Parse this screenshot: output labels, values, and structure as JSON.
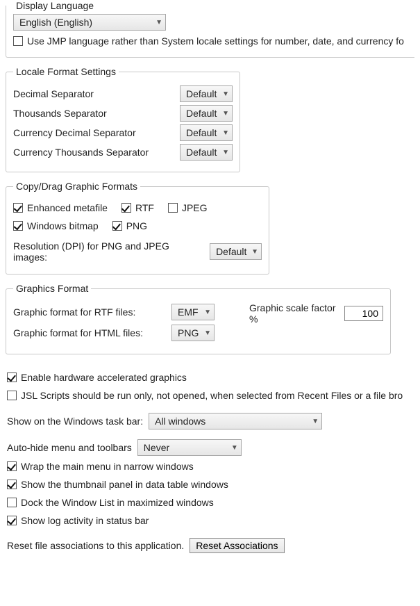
{
  "displayLanguage": {
    "legend": "Display Language",
    "selected": "English (English)",
    "useJmpLanguage": {
      "checked": false,
      "label": "Use JMP language rather than System locale settings for number, date, and currency fo"
    }
  },
  "localeFormat": {
    "legend": "Locale Format Settings",
    "rows": [
      {
        "label": "Decimal Separator",
        "value": "Default"
      },
      {
        "label": "Thousands Separator",
        "value": "Default"
      },
      {
        "label": "Currency Decimal Separator",
        "value": "Default"
      },
      {
        "label": "Currency Thousands Separator",
        "value": "Default"
      }
    ]
  },
  "copyDrag": {
    "legend": "Copy/Drag Graphic Formats",
    "formats": [
      {
        "label": "Enhanced metafile",
        "checked": true
      },
      {
        "label": "RTF",
        "checked": true
      },
      {
        "label": "JPEG",
        "checked": false
      },
      {
        "label": "Windows bitmap",
        "checked": true
      },
      {
        "label": "PNG",
        "checked": true
      }
    ],
    "resolutionLabel": "Resolution (DPI) for PNG and JPEG images:",
    "resolutionValue": "Default"
  },
  "graphicsFormat": {
    "legend": "Graphics Format",
    "rtfLabel": "Graphic format for RTF files:",
    "rtfValue": "EMF",
    "htmlLabel": "Graphic format for HTML files:",
    "htmlValue": "PNG",
    "scaleLabel": "Graphic scale factor %",
    "scaleValue": "100"
  },
  "misc": {
    "hwAccel": {
      "checked": true,
      "label": "Enable hardware accelerated graphics"
    },
    "jslScripts": {
      "checked": false,
      "label": "JSL Scripts should be run only, not opened, when selected from Recent Files or a file bro"
    },
    "taskbarLabel": "Show on the Windows task bar:",
    "taskbarValue": "All windows",
    "autohideLabel": "Auto-hide menu and toolbars",
    "autohideValue": "Never",
    "wrapMenu": {
      "checked": true,
      "label": "Wrap the main menu in narrow windows"
    },
    "thumbPanel": {
      "checked": true,
      "label": "Show the thumbnail panel in data table windows"
    },
    "dockWinList": {
      "checked": false,
      "label": "Dock the Window List in maximized windows"
    },
    "logActivity": {
      "checked": true,
      "label": "Show log activity in status bar"
    },
    "resetLabel": "Reset file associations to this application.",
    "resetButton": "Reset Associations"
  }
}
